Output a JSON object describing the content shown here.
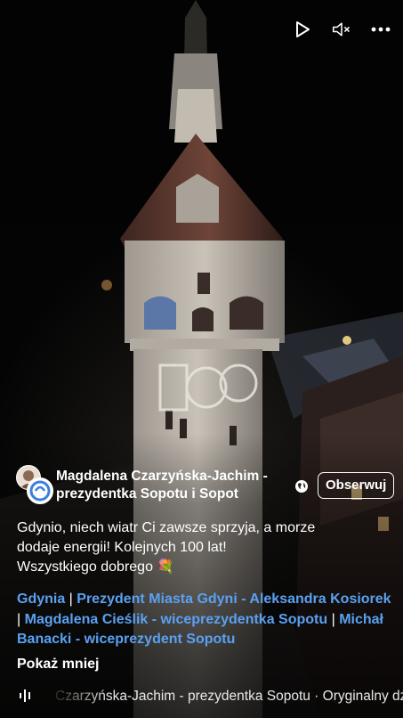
{
  "controls": {
    "play_icon": "play-icon",
    "mute_icon": "muted-speaker-icon",
    "more_icon": "more-dots-icon"
  },
  "author": {
    "name": "Magdalena Czarzyńska-Jachim - prezydentka Sopotu i Sopot",
    "privacy_icon": "globe-icon",
    "follow_label": "Obserwuj"
  },
  "caption": {
    "line1": "Gdynio, niech wiatr Ci zawsze sprzyja, a morze",
    "line2": "dodaje energii! Kolejnych 100 lat!",
    "line3": "Wszystkiego dobrego 💐"
  },
  "tags": {
    "tag1": "Gdynia",
    "sep1": " | ",
    "tag2": "Prezydent Miasta Gdyni - Aleksandra Kosiorek",
    "sep2": " | ",
    "tag3": "Magdalena Cieślik - wiceprezydentka Sopotu",
    "sep3": " | ",
    "tag4": "Michał Banacki - wiceprezydent Sopotu"
  },
  "show_less_label": "Pokaż mniej",
  "audio": {
    "icon": "audio-waveform-icon",
    "text": "Czarzyńska-Jachim - prezydentka Sopotu · Oryginalny dźwięk"
  },
  "projection_text": "100"
}
